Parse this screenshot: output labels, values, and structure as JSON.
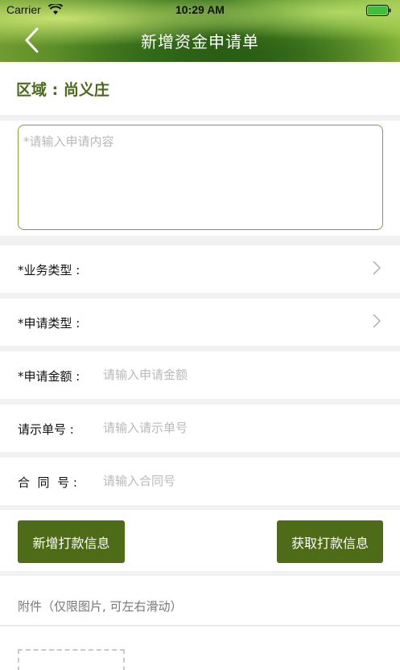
{
  "status": {
    "carrier": "Carrier",
    "time": "10:29 AM"
  },
  "nav": {
    "title": "新增资金申请单"
  },
  "area": {
    "label": "区域 : 尚义庄"
  },
  "content": {
    "placeholder": "*请输入申请内容"
  },
  "fields": [
    {
      "label": "*业务类型 :"
    },
    {
      "label": "*申请类型 :"
    },
    {
      "label": "*申请金额 :",
      "placeholder": "请输入申请金额"
    },
    {
      "label": "请示单号 :",
      "placeholder": "请输入请示单号"
    },
    {
      "label": "合  同  号 :",
      "placeholder": "请输入合同号"
    }
  ],
  "buttons": {
    "add_payment": "新增打款信息",
    "get_payment": "获取打款信息"
  },
  "attachment": {
    "label": "附件（仅限图片, 可左右滑动）"
  },
  "colors": {
    "accent": "#4e6b18",
    "area_text": "#4b6a1c",
    "border": "#8a9a3c"
  }
}
